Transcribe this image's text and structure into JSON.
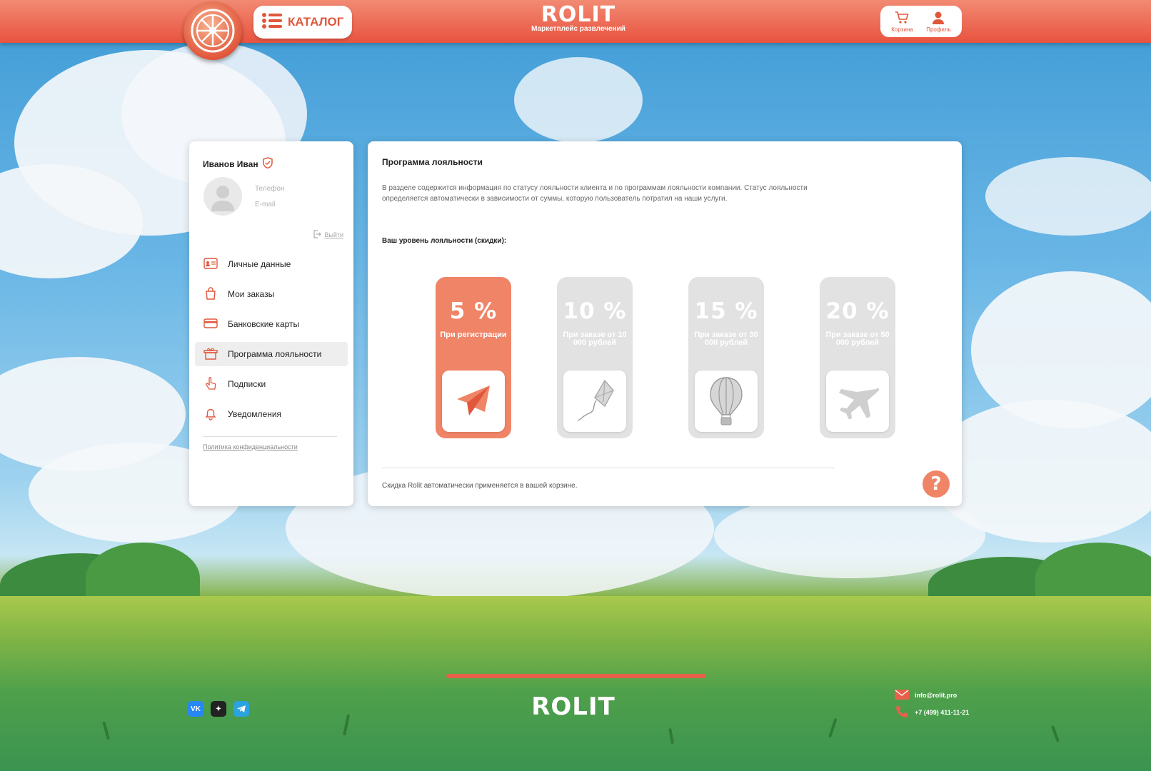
{
  "header": {
    "catalog_label": "КАТАЛОГ",
    "brand": "ROLIT",
    "tagline": "Маркетплейс развлечений",
    "cart_label": "Корзина",
    "profile_label": "Профиль"
  },
  "sidebar": {
    "user_name": "Иванов Иван",
    "phone_label": "Телефон",
    "email_label": "E-mail",
    "logout_label": "Выйти",
    "items": [
      {
        "label": "Личные данные",
        "icon": "id-card-icon"
      },
      {
        "label": "Мои заказы",
        "icon": "shopping-bag-icon"
      },
      {
        "label": "Банковские карты",
        "icon": "credit-card-icon"
      },
      {
        "label": "Программа лояльности",
        "icon": "gift-icon"
      },
      {
        "label": "Подписки",
        "icon": "pointer-hand-icon"
      },
      {
        "label": "Уведомления",
        "icon": "bell-icon"
      }
    ],
    "policy_label": "Политика конфиденциальности"
  },
  "main": {
    "title": "Программа лояльности",
    "description": "В разделе содержится информация по статусу лояльности клиента и по программам лояльности компании. Статус лояльности определяется автоматически в зависимости от суммы, которую пользователь потратил на наши услуги.",
    "level_label": "Ваш уровень лояльности (скидки):",
    "tiers": [
      {
        "percent": "5 %",
        "condition": "При регистрации",
        "icon": "paper-plane-icon",
        "active": true
      },
      {
        "percent": "10 %",
        "condition": "При заказе от 10 000 рублей",
        "icon": "kite-icon",
        "active": false
      },
      {
        "percent": "15 %",
        "condition": "При заказе от 30 000 рублей",
        "icon": "hot-air-balloon-icon",
        "active": false
      },
      {
        "percent": "20 %",
        "condition": "При заказе от 50 000 рублей",
        "icon": "airplane-icon",
        "active": false
      }
    ],
    "note": "Скидка Rolit автоматически применяется в вашей корзине.",
    "help_label": "?"
  },
  "footer": {
    "brand": "ROLIT",
    "email": "info@rolit.pro",
    "phone": "+7 (499) 411-11-21",
    "socials": [
      "vk-icon",
      "zen-icon",
      "telegram-icon"
    ]
  },
  "colors": {
    "accent": "#e8533f",
    "tier_active": "#f08467",
    "tier_inactive": "#e2e2e2"
  }
}
